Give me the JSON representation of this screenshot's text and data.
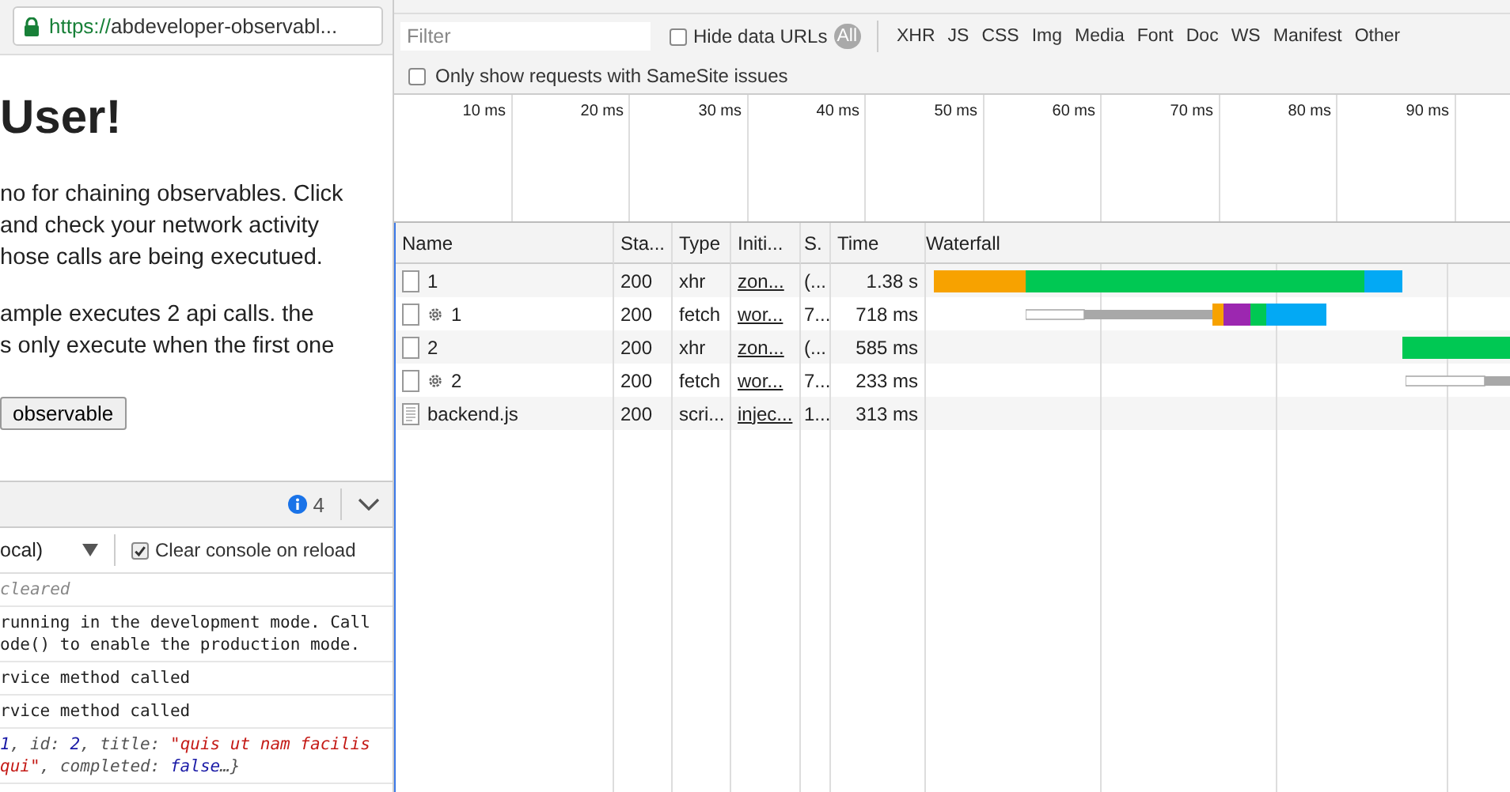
{
  "browser": {
    "url_secure": "https://",
    "url_rest": "abdeveloper-observabl..."
  },
  "page": {
    "heading": "User!",
    "paragraphs": [
      [
        "no for chaining observables. Click",
        "and check your network activity",
        "hose calls are being executued."
      ],
      [
        "ample executes 2 api calls. the",
        "s only execute when the first one"
      ]
    ],
    "button": "observable"
  },
  "console": {
    "info_count": "4",
    "context": "ocal)",
    "clear_on_reload": {
      "label": "Clear console on reload",
      "checked": true
    },
    "messages": [
      {
        "kind": "note",
        "lines": [
          [
            {
              "kind": "plain",
              "text": "cleared"
            }
          ]
        ]
      },
      {
        "kind": "log",
        "lines": [
          [
            {
              "kind": "plain",
              "text": "running in the development mode. Call"
            }
          ],
          [
            {
              "kind": "plain",
              "text": "ode() to enable the production mode."
            }
          ]
        ]
      },
      {
        "kind": "log",
        "lines": [
          [
            {
              "kind": "plain",
              "text": "rvice method called"
            }
          ]
        ]
      },
      {
        "kind": "log",
        "lines": [
          [
            {
              "kind": "plain",
              "text": "rvice method called"
            }
          ]
        ]
      },
      {
        "kind": "object",
        "lines": [
          [
            {
              "kind": "number",
              "text": "1"
            },
            {
              "kind": "key",
              "text": ", id: "
            },
            {
              "kind": "number",
              "text": "2"
            },
            {
              "kind": "key",
              "text": ", title: "
            },
            {
              "kind": "string",
              "text": "\"quis ut nam facilis"
            }
          ],
          [
            {
              "kind": "string",
              "text": "qui\""
            },
            {
              "kind": "key",
              "text": ", completed: "
            },
            {
              "kind": "number",
              "text": "false"
            },
            {
              "kind": "key",
              "text": "…}"
            }
          ]
        ]
      }
    ]
  },
  "network": {
    "filter": {
      "placeholder": "Filter"
    },
    "hide_data_urls": {
      "label": "Hide data URLs",
      "checked": false
    },
    "types": [
      {
        "label": "All",
        "selected": true
      },
      {
        "label": "XHR",
        "selected": false
      },
      {
        "label": "JS",
        "selected": false
      },
      {
        "label": "CSS",
        "selected": false
      },
      {
        "label": "Img",
        "selected": false
      },
      {
        "label": "Media",
        "selected": false
      },
      {
        "label": "Font",
        "selected": false
      },
      {
        "label": "Doc",
        "selected": false
      },
      {
        "label": "WS",
        "selected": false
      },
      {
        "label": "Manifest",
        "selected": false
      },
      {
        "label": "Other",
        "selected": false
      }
    ],
    "samesite": {
      "label": "Only show requests with SameSite issues",
      "checked": false
    },
    "overview_ticks": [
      "10 ms",
      "20 ms",
      "30 ms",
      "40 ms",
      "50 ms",
      "60 ms",
      "70 ms",
      "80 ms",
      "90 ms"
    ],
    "table": {
      "columns": [
        "Name",
        "Sta...",
        "Type",
        "Initi...",
        "S.",
        "Time",
        "Waterfall"
      ],
      "rows": [
        {
          "kind": "xhr",
          "name": "1",
          "status": "200",
          "type": "xhr",
          "initiator": "zon...",
          "size": "(...",
          "time": "1.38 s"
        },
        {
          "kind": "fetch",
          "name": "1",
          "status": "200",
          "type": "fetch",
          "initiator": "wor...",
          "size": "7...",
          "time": "718 ms"
        },
        {
          "kind": "xhr",
          "name": "2",
          "status": "200",
          "type": "xhr",
          "initiator": "zon...",
          "size": "(...",
          "time": "585 ms"
        },
        {
          "kind": "fetch",
          "name": "2",
          "status": "200",
          "type": "fetch",
          "initiator": "wor...",
          "size": "7...",
          "time": "233 ms"
        },
        {
          "kind": "script",
          "name": "backend.js",
          "status": "200",
          "type": "scri...",
          "initiator": "injec...",
          "size": "1...",
          "time": "313 ms"
        }
      ]
    }
  }
}
